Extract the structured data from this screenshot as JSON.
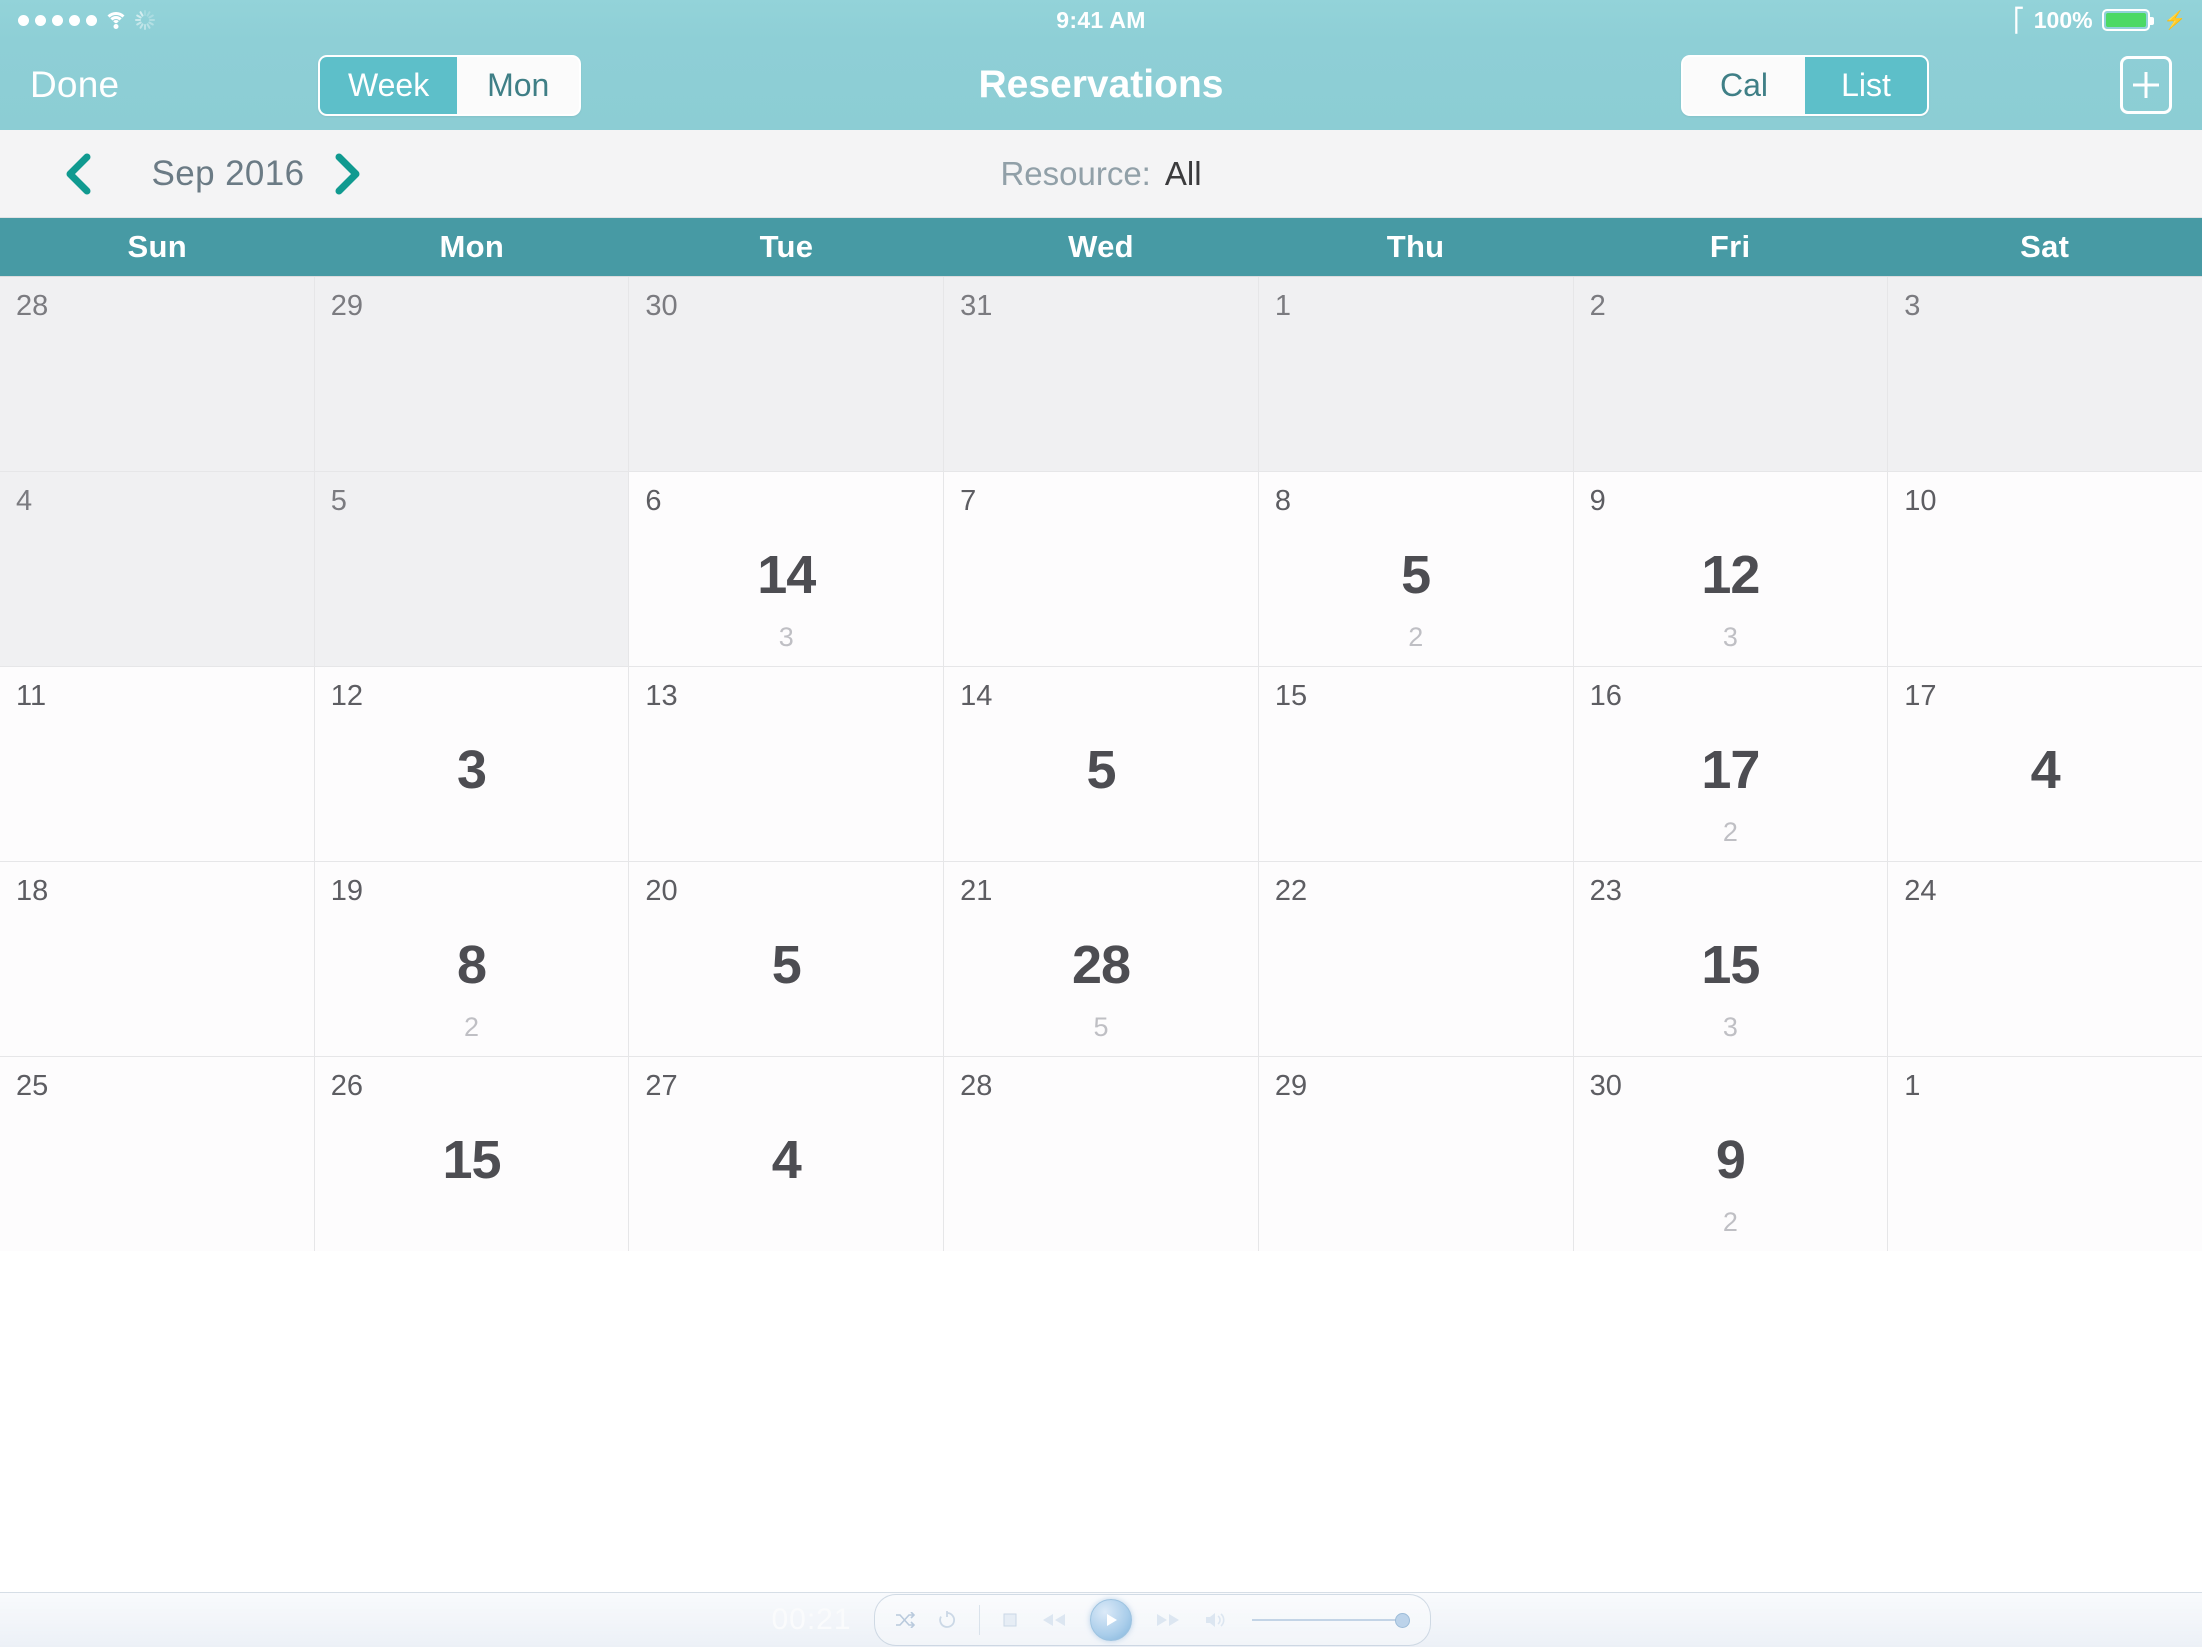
{
  "status_bar": {
    "signal_dots": 5,
    "wifi": "wifi-icon",
    "activity": "activity-spinner-icon",
    "time": "9:41 AM",
    "bluetooth": "bluetooth-icon",
    "battery_percent": "100%",
    "battery_state": "charging"
  },
  "nav_bar": {
    "done_label": "Done",
    "title": "Reservations",
    "view_scope": {
      "options": [
        "Week",
        "Mon"
      ],
      "selected": "Week"
    },
    "view_mode": {
      "options": [
        "Cal",
        "List"
      ],
      "selected": "List"
    },
    "add_label": "+"
  },
  "subheader": {
    "prev_label": "‹",
    "next_label": "›",
    "month": "Sep 2016",
    "resource_label": "Resource:",
    "resource_value": "All"
  },
  "weekdays": [
    "Sun",
    "Mon",
    "Tue",
    "Wed",
    "Thu",
    "Fri",
    "Sat"
  ],
  "colors": {
    "status_bar": "#93d3d9",
    "nav_bar": "#8ecfd6",
    "weekday_header": "#479aa4",
    "accent_teal": "#5dbfc9",
    "chevron_teal": "#109a90",
    "subheader_bg": "#f4f4f5",
    "cell_bg": "#fdfcfd",
    "cell_dim_bg": "#f0f0f2",
    "main_number": "#4d4d52",
    "sub_number": "#bfbfc4",
    "battery_fill": "#4cd964"
  },
  "calendar": {
    "rows": [
      [
        {
          "day": "28",
          "dim": true,
          "main": "",
          "sub": ""
        },
        {
          "day": "29",
          "dim": true,
          "main": "",
          "sub": ""
        },
        {
          "day": "30",
          "dim": true,
          "main": "",
          "sub": ""
        },
        {
          "day": "31",
          "dim": true,
          "main": "",
          "sub": ""
        },
        {
          "day": "1",
          "dim": true,
          "main": "",
          "sub": ""
        },
        {
          "day": "2",
          "dim": true,
          "main": "",
          "sub": ""
        },
        {
          "day": "3",
          "dim": true,
          "main": "",
          "sub": ""
        }
      ],
      [
        {
          "day": "4",
          "dim": true,
          "main": "",
          "sub": ""
        },
        {
          "day": "5",
          "dim": true,
          "main": "",
          "sub": ""
        },
        {
          "day": "6",
          "dim": false,
          "main": "14",
          "sub": "3"
        },
        {
          "day": "7",
          "dim": false,
          "main": "",
          "sub": ""
        },
        {
          "day": "8",
          "dim": false,
          "main": "5",
          "sub": "2"
        },
        {
          "day": "9",
          "dim": false,
          "main": "12",
          "sub": "3"
        },
        {
          "day": "10",
          "dim": false,
          "main": "",
          "sub": ""
        }
      ],
      [
        {
          "day": "11",
          "dim": false,
          "main": "",
          "sub": ""
        },
        {
          "day": "12",
          "dim": false,
          "main": "3",
          "sub": ""
        },
        {
          "day": "13",
          "dim": false,
          "main": "",
          "sub": ""
        },
        {
          "day": "14",
          "dim": false,
          "main": "5",
          "sub": ""
        },
        {
          "day": "15",
          "dim": false,
          "main": "",
          "sub": ""
        },
        {
          "day": "16",
          "dim": false,
          "main": "17",
          "sub": "2"
        },
        {
          "day": "17",
          "dim": false,
          "main": "4",
          "sub": ""
        }
      ],
      [
        {
          "day": "18",
          "dim": false,
          "main": "",
          "sub": ""
        },
        {
          "day": "19",
          "dim": false,
          "main": "8",
          "sub": "2"
        },
        {
          "day": "20",
          "dim": false,
          "main": "5",
          "sub": ""
        },
        {
          "day": "21",
          "dim": false,
          "main": "28",
          "sub": "5"
        },
        {
          "day": "22",
          "dim": false,
          "main": "",
          "sub": ""
        },
        {
          "day": "23",
          "dim": false,
          "main": "15",
          "sub": "3"
        },
        {
          "day": "24",
          "dim": false,
          "main": "",
          "sub": ""
        }
      ],
      [
        {
          "day": "25",
          "dim": false,
          "main": "",
          "sub": ""
        },
        {
          "day": "26",
          "dim": false,
          "main": "15",
          "sub": ""
        },
        {
          "day": "27",
          "dim": false,
          "main": "4",
          "sub": ""
        },
        {
          "day": "28",
          "dim": false,
          "main": "",
          "sub": ""
        },
        {
          "day": "29",
          "dim": false,
          "main": "",
          "sub": ""
        },
        {
          "day": "30",
          "dim": false,
          "main": "9",
          "sub": "2"
        },
        {
          "day": "1",
          "dim": false,
          "main": "",
          "sub": ""
        }
      ]
    ]
  },
  "video_player": {
    "time": "00:21",
    "controls": [
      "shuffle-icon",
      "repeat-icon",
      "stop-icon",
      "rewind-icon",
      "play-icon",
      "fast-forward-icon",
      "volume-icon"
    ],
    "volume_position_percent": 100
  }
}
